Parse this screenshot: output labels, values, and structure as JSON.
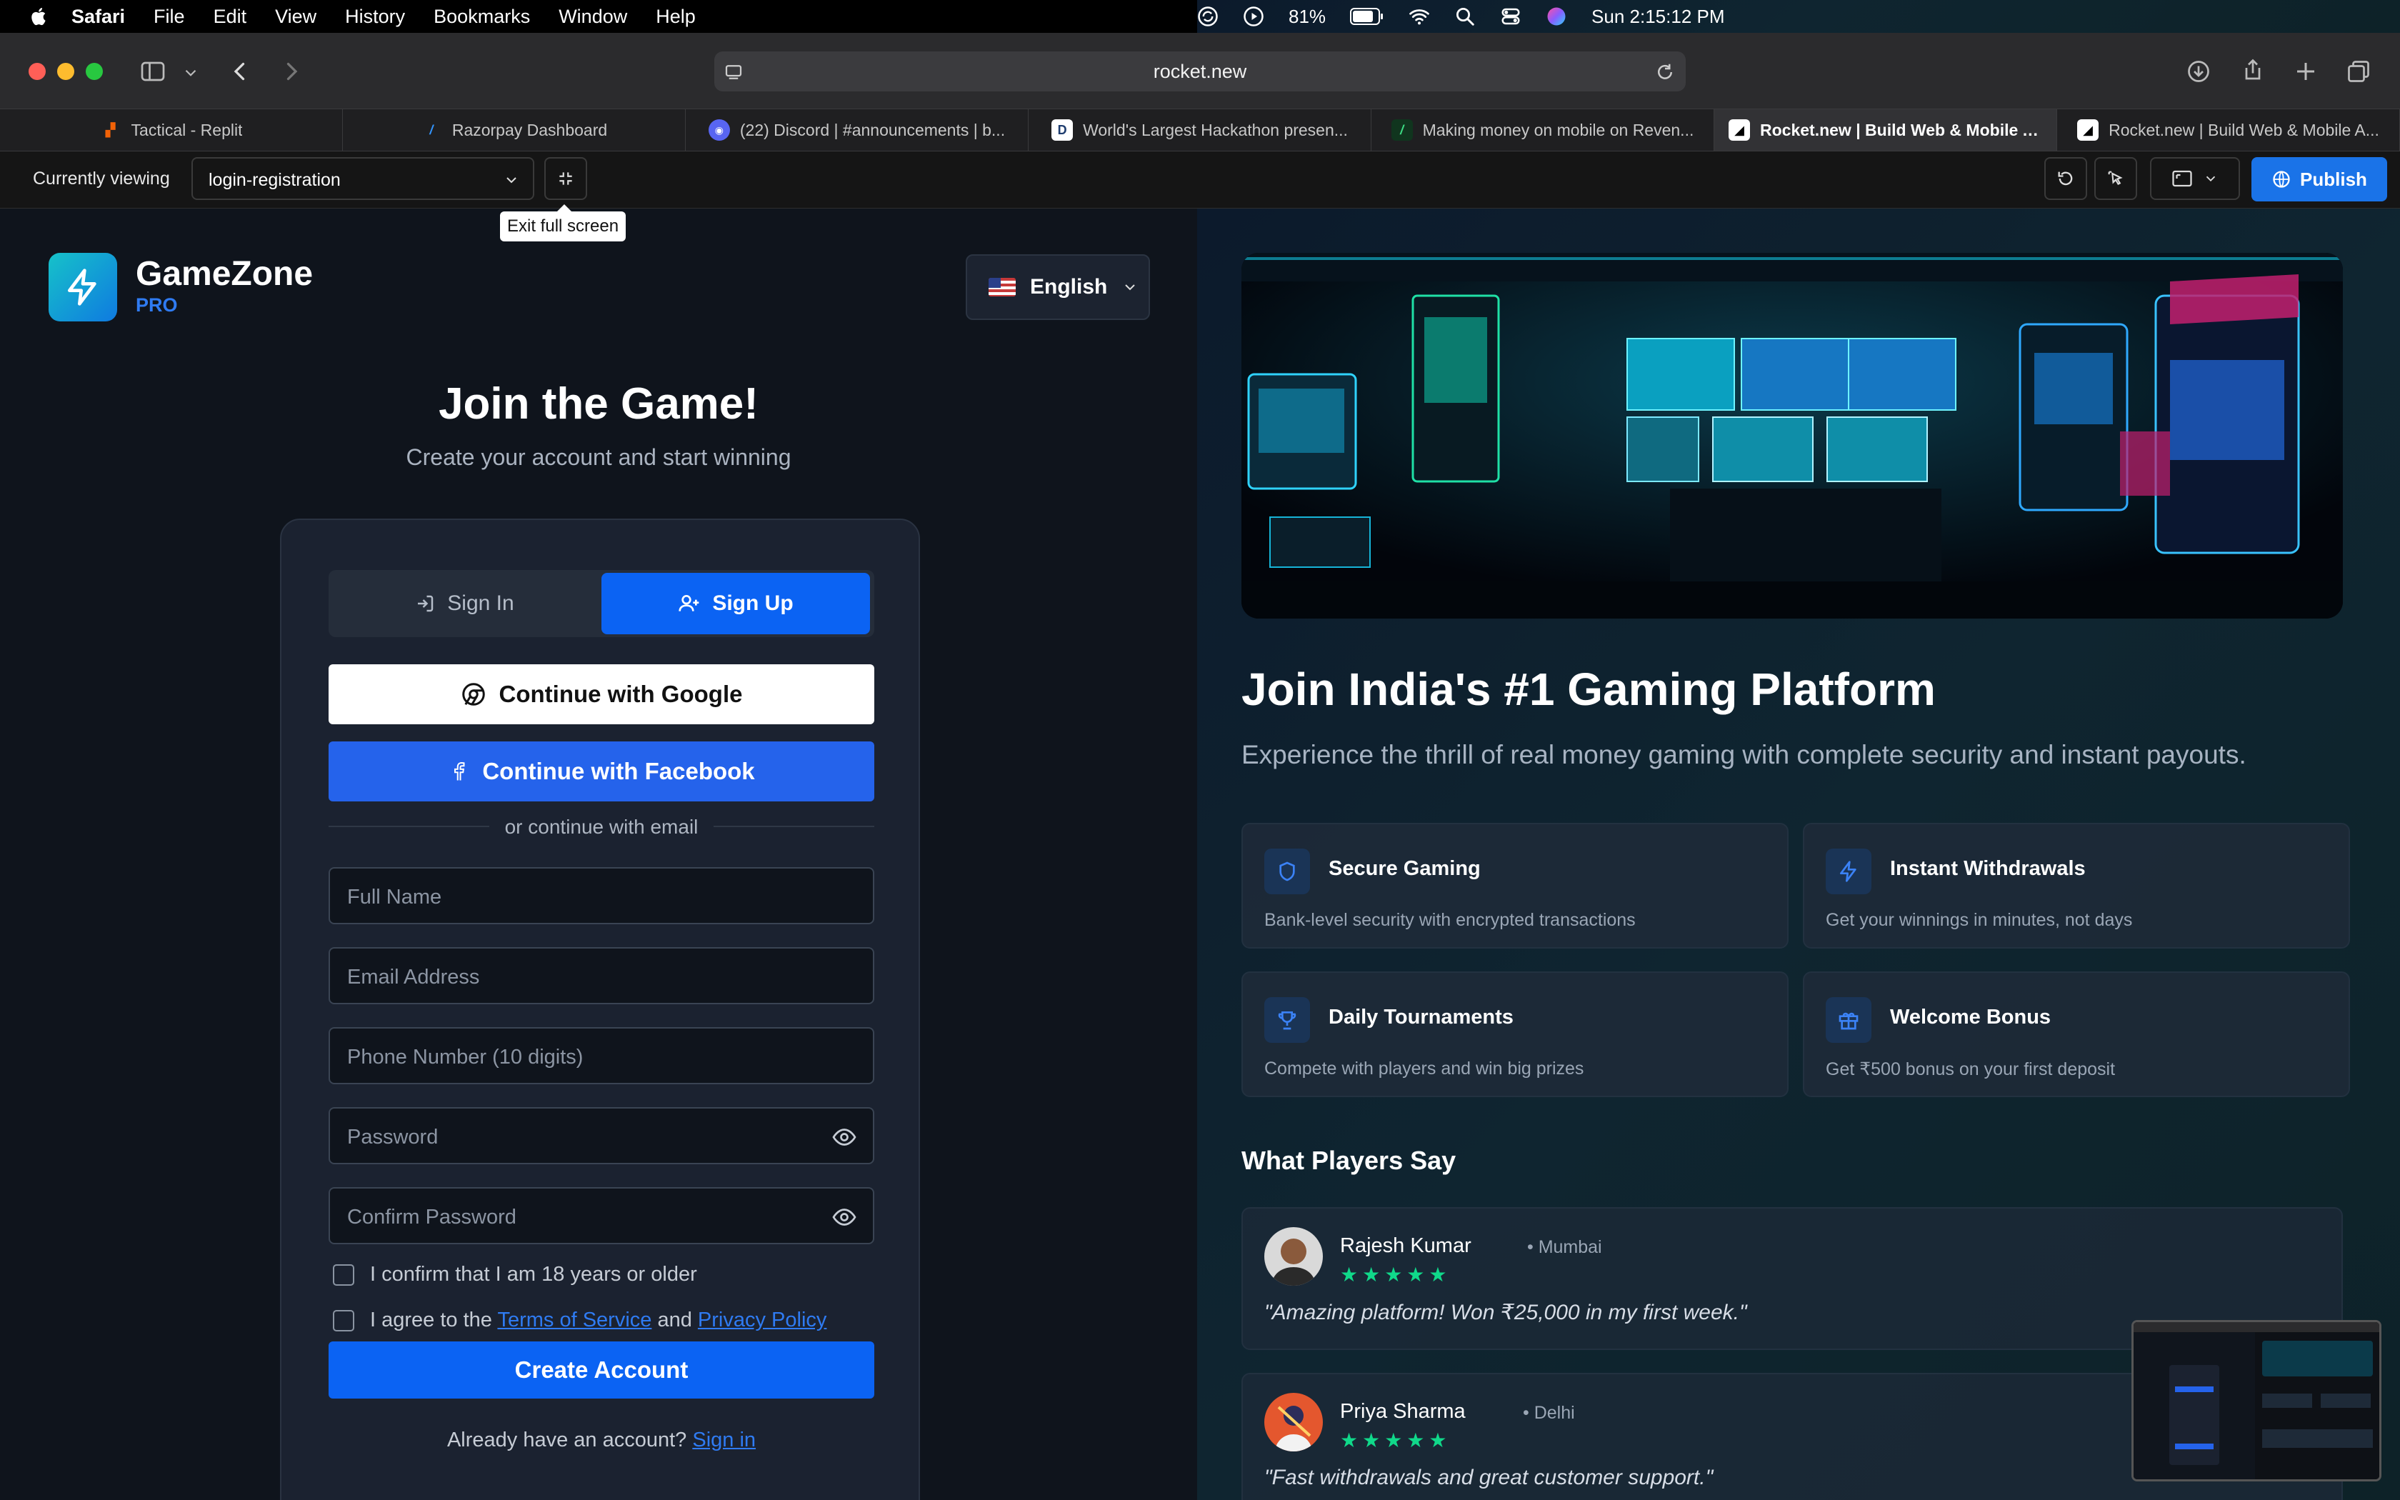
{
  "menubar": {
    "app": "Safari",
    "items": [
      "File",
      "Edit",
      "View",
      "History",
      "Bookmarks",
      "Window",
      "Help"
    ],
    "battery": "81%",
    "clock": "Sun 2:15:12 PM"
  },
  "browser": {
    "url": "rocket.new",
    "tabs": [
      {
        "title": "Tactical - Replit",
        "fav": "replit"
      },
      {
        "title": "Razorpay Dashboard",
        "fav": "razorpay"
      },
      {
        "title": "(22) Discord | #announcements | b...",
        "fav": "discord"
      },
      {
        "title": "World's Largest Hackathon presen...",
        "fav": "D"
      },
      {
        "title": "Making money on mobile on Reven...",
        "fav": "rc"
      },
      {
        "title": "Rocket.new | Build Web & Mobile A...",
        "fav": "rocket",
        "active": true
      },
      {
        "title": "Rocket.new | Build Web & Mobile A...",
        "fav": "rocket"
      }
    ]
  },
  "rocketbar": {
    "label": "Currently viewing",
    "selected": "login-registration",
    "tooltip": "Exit full screen",
    "publish": "Publish"
  },
  "brand": {
    "name": "GameZone",
    "tier": "PRO"
  },
  "language": "English",
  "auth": {
    "title": "Join the Game!",
    "subtitle": "Create your account and start winning",
    "tab_signin": "Sign In",
    "tab_signup": "Sign Up",
    "google": "Continue with Google",
    "facebook": "Continue with Facebook",
    "divider": "or continue with email",
    "ph_name": "Full Name",
    "ph_email": "Email Address",
    "ph_phone": "Phone Number (10 digits)",
    "ph_password": "Password",
    "ph_confirm": "Confirm Password",
    "age_confirm": "I confirm that I am 18 years or older",
    "agree_prefix": "I agree to the",
    "terms": "Terms of Service",
    "and": "and",
    "privacy": "Privacy Policy",
    "create": "Create Account",
    "already": "Already have an account?",
    "signin_link": "Sign in"
  },
  "promo": {
    "title": "Join India's #1 Gaming Platform",
    "subtitle": "Experience the thrill of real money gaming with complete security and instant payouts.",
    "features": [
      {
        "icon": "shield-icon",
        "title": "Secure Gaming",
        "desc": "Bank-level security with encrypted transactions"
      },
      {
        "icon": "bolt-icon",
        "title": "Instant Withdrawals",
        "desc": "Get your winnings in minutes, not days"
      },
      {
        "icon": "trophy-icon",
        "title": "Daily Tournaments",
        "desc": "Compete with players and win big prizes"
      },
      {
        "icon": "gift-icon",
        "title": "Welcome Bonus",
        "desc": "Get ₹500 bonus on your first deposit"
      }
    ],
    "testimonials_title": "What Players Say",
    "testimonials": [
      {
        "name": "Rajesh Kumar",
        "city": "• Mumbai",
        "stars": "★★★★★",
        "quote": "\"Amazing platform! Won ₹25,000 in my first week.\""
      },
      {
        "name": "Priya Sharma",
        "city": "• Delhi",
        "stars": "★★★★★",
        "quote": "\"Fast withdrawals and great customer support.\""
      }
    ]
  },
  "colors": {
    "accent": "#0b63f3",
    "brand_teal": "#16c2c9",
    "star": "#10d98a"
  }
}
